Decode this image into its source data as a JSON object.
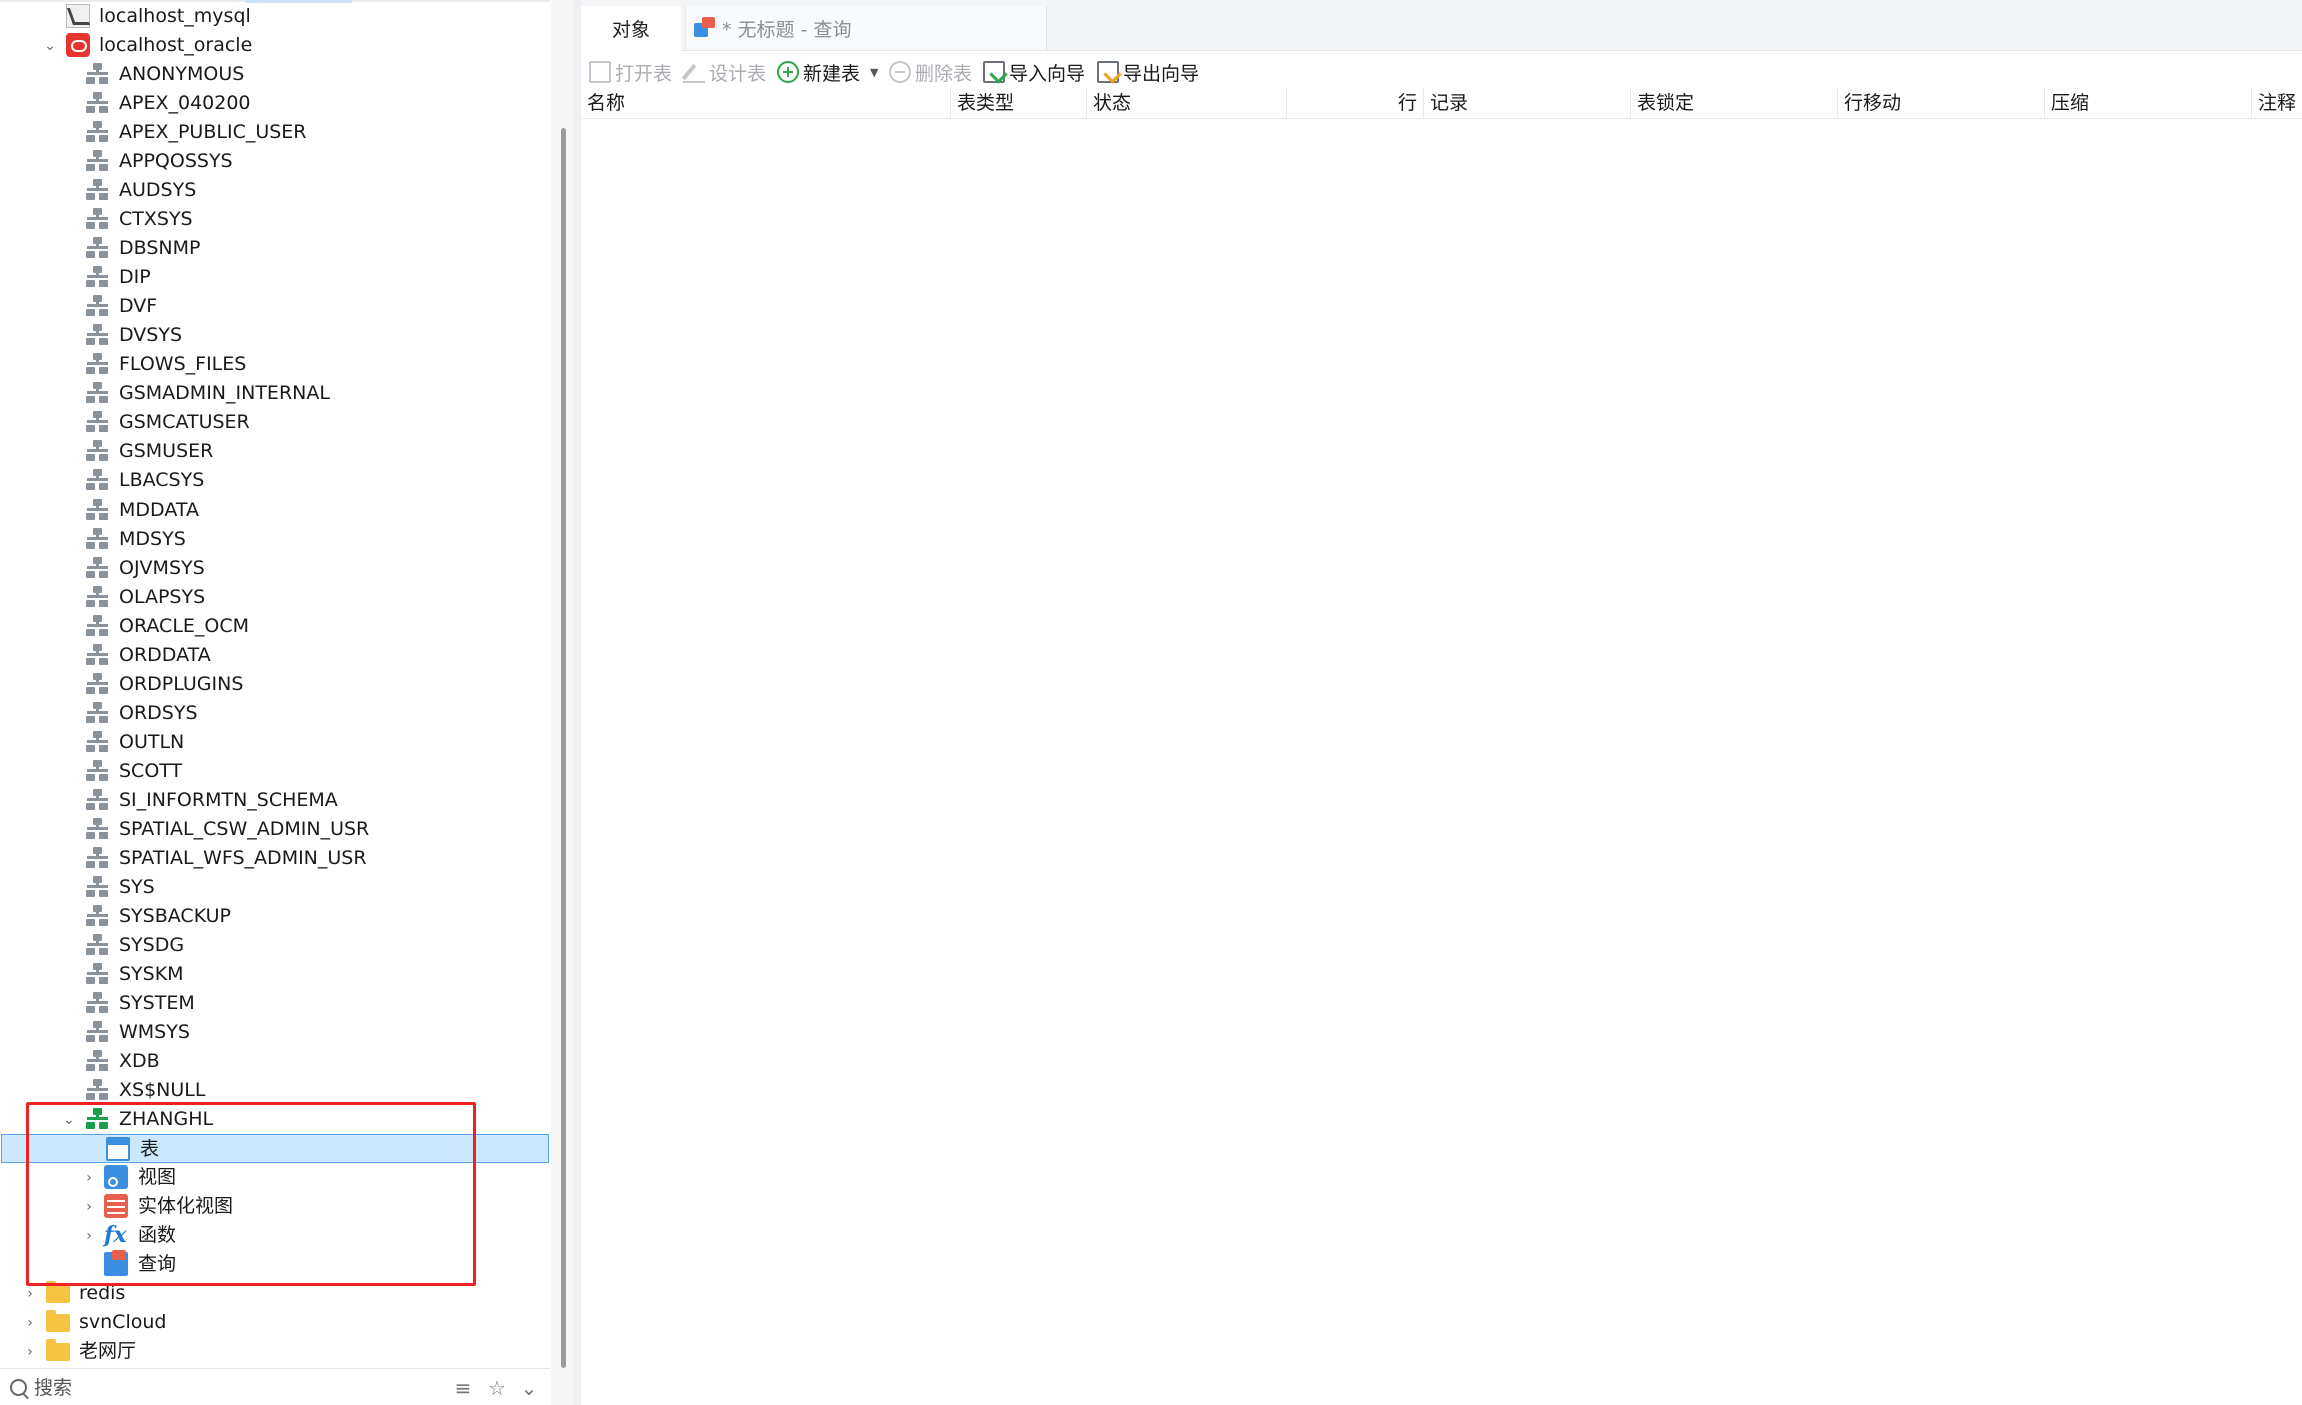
{
  "sidebar": {
    "connections": [
      {
        "label": "localhost_mysql",
        "icon": "mysql-icon"
      },
      {
        "label": "localhost_oracle",
        "icon": "oracle-icon"
      }
    ],
    "schemas": [
      "ANONYMOUS",
      "APEX_040200",
      "APEX_PUBLIC_USER",
      "APPQOSSYS",
      "AUDSYS",
      "CTXSYS",
      "DBSNMP",
      "DIP",
      "DVF",
      "DVSYS",
      "FLOWS_FILES",
      "GSMADMIN_INTERNAL",
      "GSMCATUSER",
      "GSMUSER",
      "LBACSYS",
      "MDDATA",
      "MDSYS",
      "OJVMSYS",
      "OLAPSYS",
      "ORACLE_OCM",
      "ORDDATA",
      "ORDPLUGINS",
      "ORDSYS",
      "OUTLN",
      "SCOTT",
      "SI_INFORMTN_SCHEMA",
      "SPATIAL_CSW_ADMIN_USR",
      "SPATIAL_WFS_ADMIN_USR",
      "SYS",
      "SYSBACKUP",
      "SYSDG",
      "SYSKM",
      "SYSTEM",
      "WMSYS",
      "XDB",
      "XS$NULL"
    ],
    "expanded_schema": "ZHANGHL",
    "schema_children": [
      {
        "label": "表",
        "icon": "table-icon",
        "selected": true
      },
      {
        "label": "视图",
        "icon": "view-icon",
        "expandable": true
      },
      {
        "label": "实体化视图",
        "icon": "materialized-view-icon",
        "expandable": true
      },
      {
        "label": "函数",
        "icon": "function-icon",
        "expandable": true
      },
      {
        "label": "查询",
        "icon": "query-icon"
      }
    ],
    "other_connections": [
      {
        "label": "redis",
        "icon": "folder-icon"
      },
      {
        "label": "svnCloud",
        "icon": "folder-icon"
      },
      {
        "label": "老网厅",
        "icon": "folder-icon"
      }
    ],
    "search_placeholder": "搜索",
    "highlight_color": "#ee2222"
  },
  "tabs": {
    "objects": "对象",
    "query": "* 无标题 - 查询"
  },
  "toolbar": {
    "open_table": "打开表",
    "design_table": "设计表",
    "new_table": "新建表",
    "delete_table": "删除表",
    "import_wizard": "导入向导",
    "export_wizard": "导出向导"
  },
  "grid": {
    "columns": [
      "名称",
      "表类型",
      "状态",
      "行",
      "记录",
      "表锁定",
      "行移动",
      "压缩",
      "注释"
    ]
  },
  "colors": {
    "accent": "#3b8fe0",
    "selection": "#cce8ff",
    "schema_active": "#1b9e4b"
  }
}
